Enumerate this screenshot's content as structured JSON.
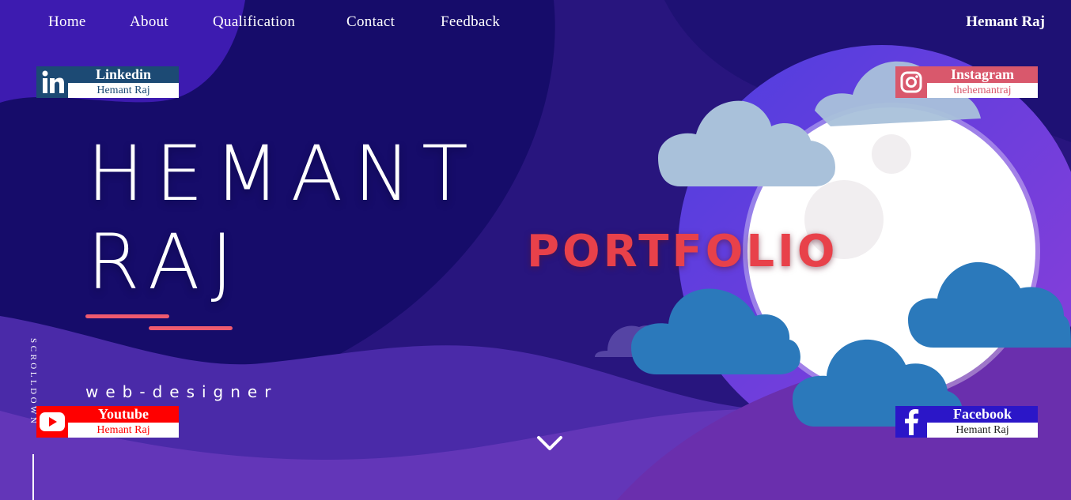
{
  "nav": {
    "items": [
      {
        "label": "Home"
      },
      {
        "label": "About"
      },
      {
        "label": "Qualification"
      },
      {
        "label": "Contact"
      },
      {
        "label": "Feedback"
      }
    ],
    "brand": "Hemant Raj"
  },
  "social": {
    "linkedin": {
      "name": "Linkedin",
      "handle": "Hemant Raj",
      "icon": "linkedin-icon",
      "color": "#1c4a74"
    },
    "instagram": {
      "name": "Instagram",
      "handle": "thehemantraj",
      "icon": "instagram-icon",
      "color": "#d9586c"
    },
    "youtube": {
      "name": "Youtube",
      "handle": "Hemant Raj",
      "icon": "youtube-icon",
      "color": "#ff0000"
    },
    "facebook": {
      "name": "Facebook",
      "handle": "Hemant Raj",
      "icon": "facebook-icon",
      "color": "#2b16c8"
    }
  },
  "hero": {
    "first_name": "HEMANT",
    "last_name": "RAJ",
    "role": "web-designer",
    "portfolio": "PORTFOLIO",
    "scroll_label": "SCROLLDOWN"
  },
  "colors": {
    "background": "#1a0f6e",
    "accent": "#ef5a6f",
    "portfolio": "#e8414a"
  }
}
